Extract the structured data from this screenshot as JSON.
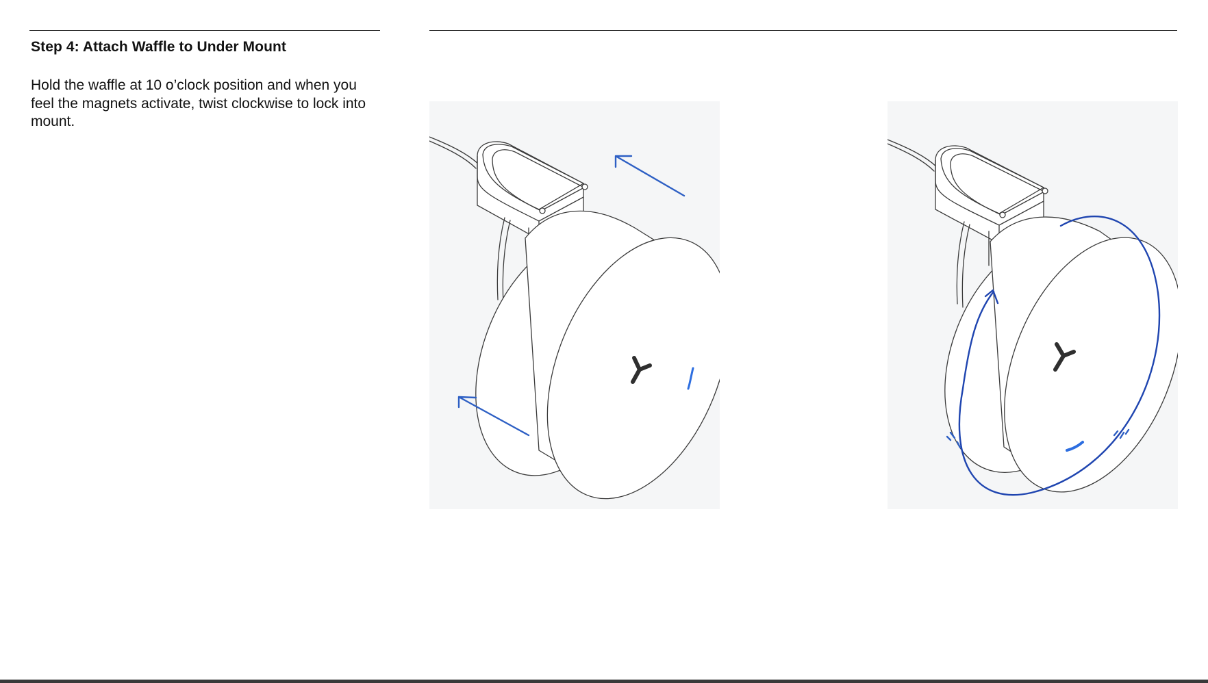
{
  "step": {
    "title": "Step 4: Attach Waffle to Under Mount",
    "body": "Hold the waffle at 10 o’clock position and when you feel the magnets activate, twist clockwise to lock into mount."
  },
  "illustrations": [
    {
      "icon": "waffle-attach-illustration"
    },
    {
      "icon": "waffle-twist-lock-illustration"
    }
  ],
  "colors": {
    "accent": "#2d5fc4",
    "panel_background": "#f5f6f7",
    "text": "#111111"
  }
}
